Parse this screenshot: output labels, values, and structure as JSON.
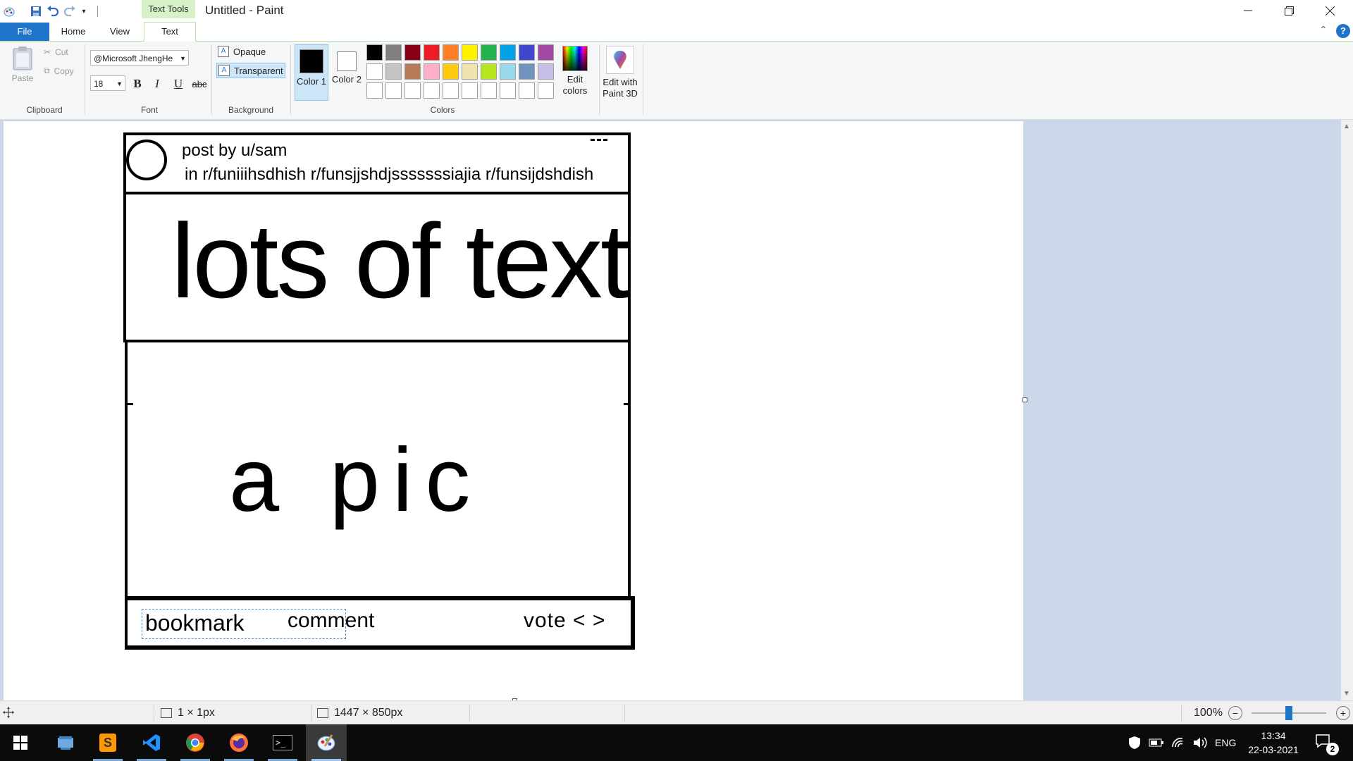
{
  "window": {
    "title": "Untitled - Paint",
    "context_tab_group": "Text Tools",
    "tabs": [
      {
        "label": "File"
      },
      {
        "label": "Home"
      },
      {
        "label": "View"
      },
      {
        "label": "Text"
      }
    ]
  },
  "ribbon": {
    "clipboard": {
      "paste_label": "Paste",
      "cut_label": "Cut",
      "copy_label": "Copy",
      "group_label": "Clipboard"
    },
    "font": {
      "family": "@Microsoft JhengHe",
      "size": "18",
      "bold": "B",
      "italic": "I",
      "underline": "U",
      "strike": "abc",
      "group_label": "Font"
    },
    "background": {
      "opaque_label": "Opaque",
      "transparent_label": "Transparent",
      "selected": "Transparent",
      "group_label": "Background"
    },
    "colors": {
      "color1_label": "Color 1",
      "color2_label": "Color 2",
      "color1_value": "#000000",
      "color2_value": "#ffffff",
      "edit_colors_label": "Edit colors",
      "group_label": "Colors",
      "palette_row1": [
        "#000000",
        "#7f7f7f",
        "#880015",
        "#ed1c24",
        "#ff7f27",
        "#fff200",
        "#22b14c",
        "#00a2e8",
        "#3f48cc",
        "#a349a4"
      ],
      "palette_row2": [
        "#ffffff",
        "#c3c3c3",
        "#b97a57",
        "#ffaec9",
        "#ffc90e",
        "#efe4b0",
        "#b5e61d",
        "#99d9ea",
        "#7092be",
        "#c8bfe7"
      ]
    },
    "paint3d": {
      "label": "Edit with Paint 3D"
    }
  },
  "canvas": {
    "post_header_user": "post by u/sam",
    "post_header_subs": "in r/funiiihsdhish r/funsjjshdjsssssssiajia r/funsijdshdish",
    "post_menu": "---",
    "body_text": "lots of text",
    "pic_text": "a pic",
    "footer_bookmark": "bookmark",
    "footer_comment": "comment",
    "footer_vote": "vote < >"
  },
  "status": {
    "selection_size": "1 × 1px",
    "image_size": "1447 × 850px",
    "zoom": "100%",
    "zoom_fraction": 0.5
  },
  "taskbar": {
    "language": "ENG",
    "time": "13:34",
    "date": "22-03-2021",
    "notifications": "2"
  }
}
